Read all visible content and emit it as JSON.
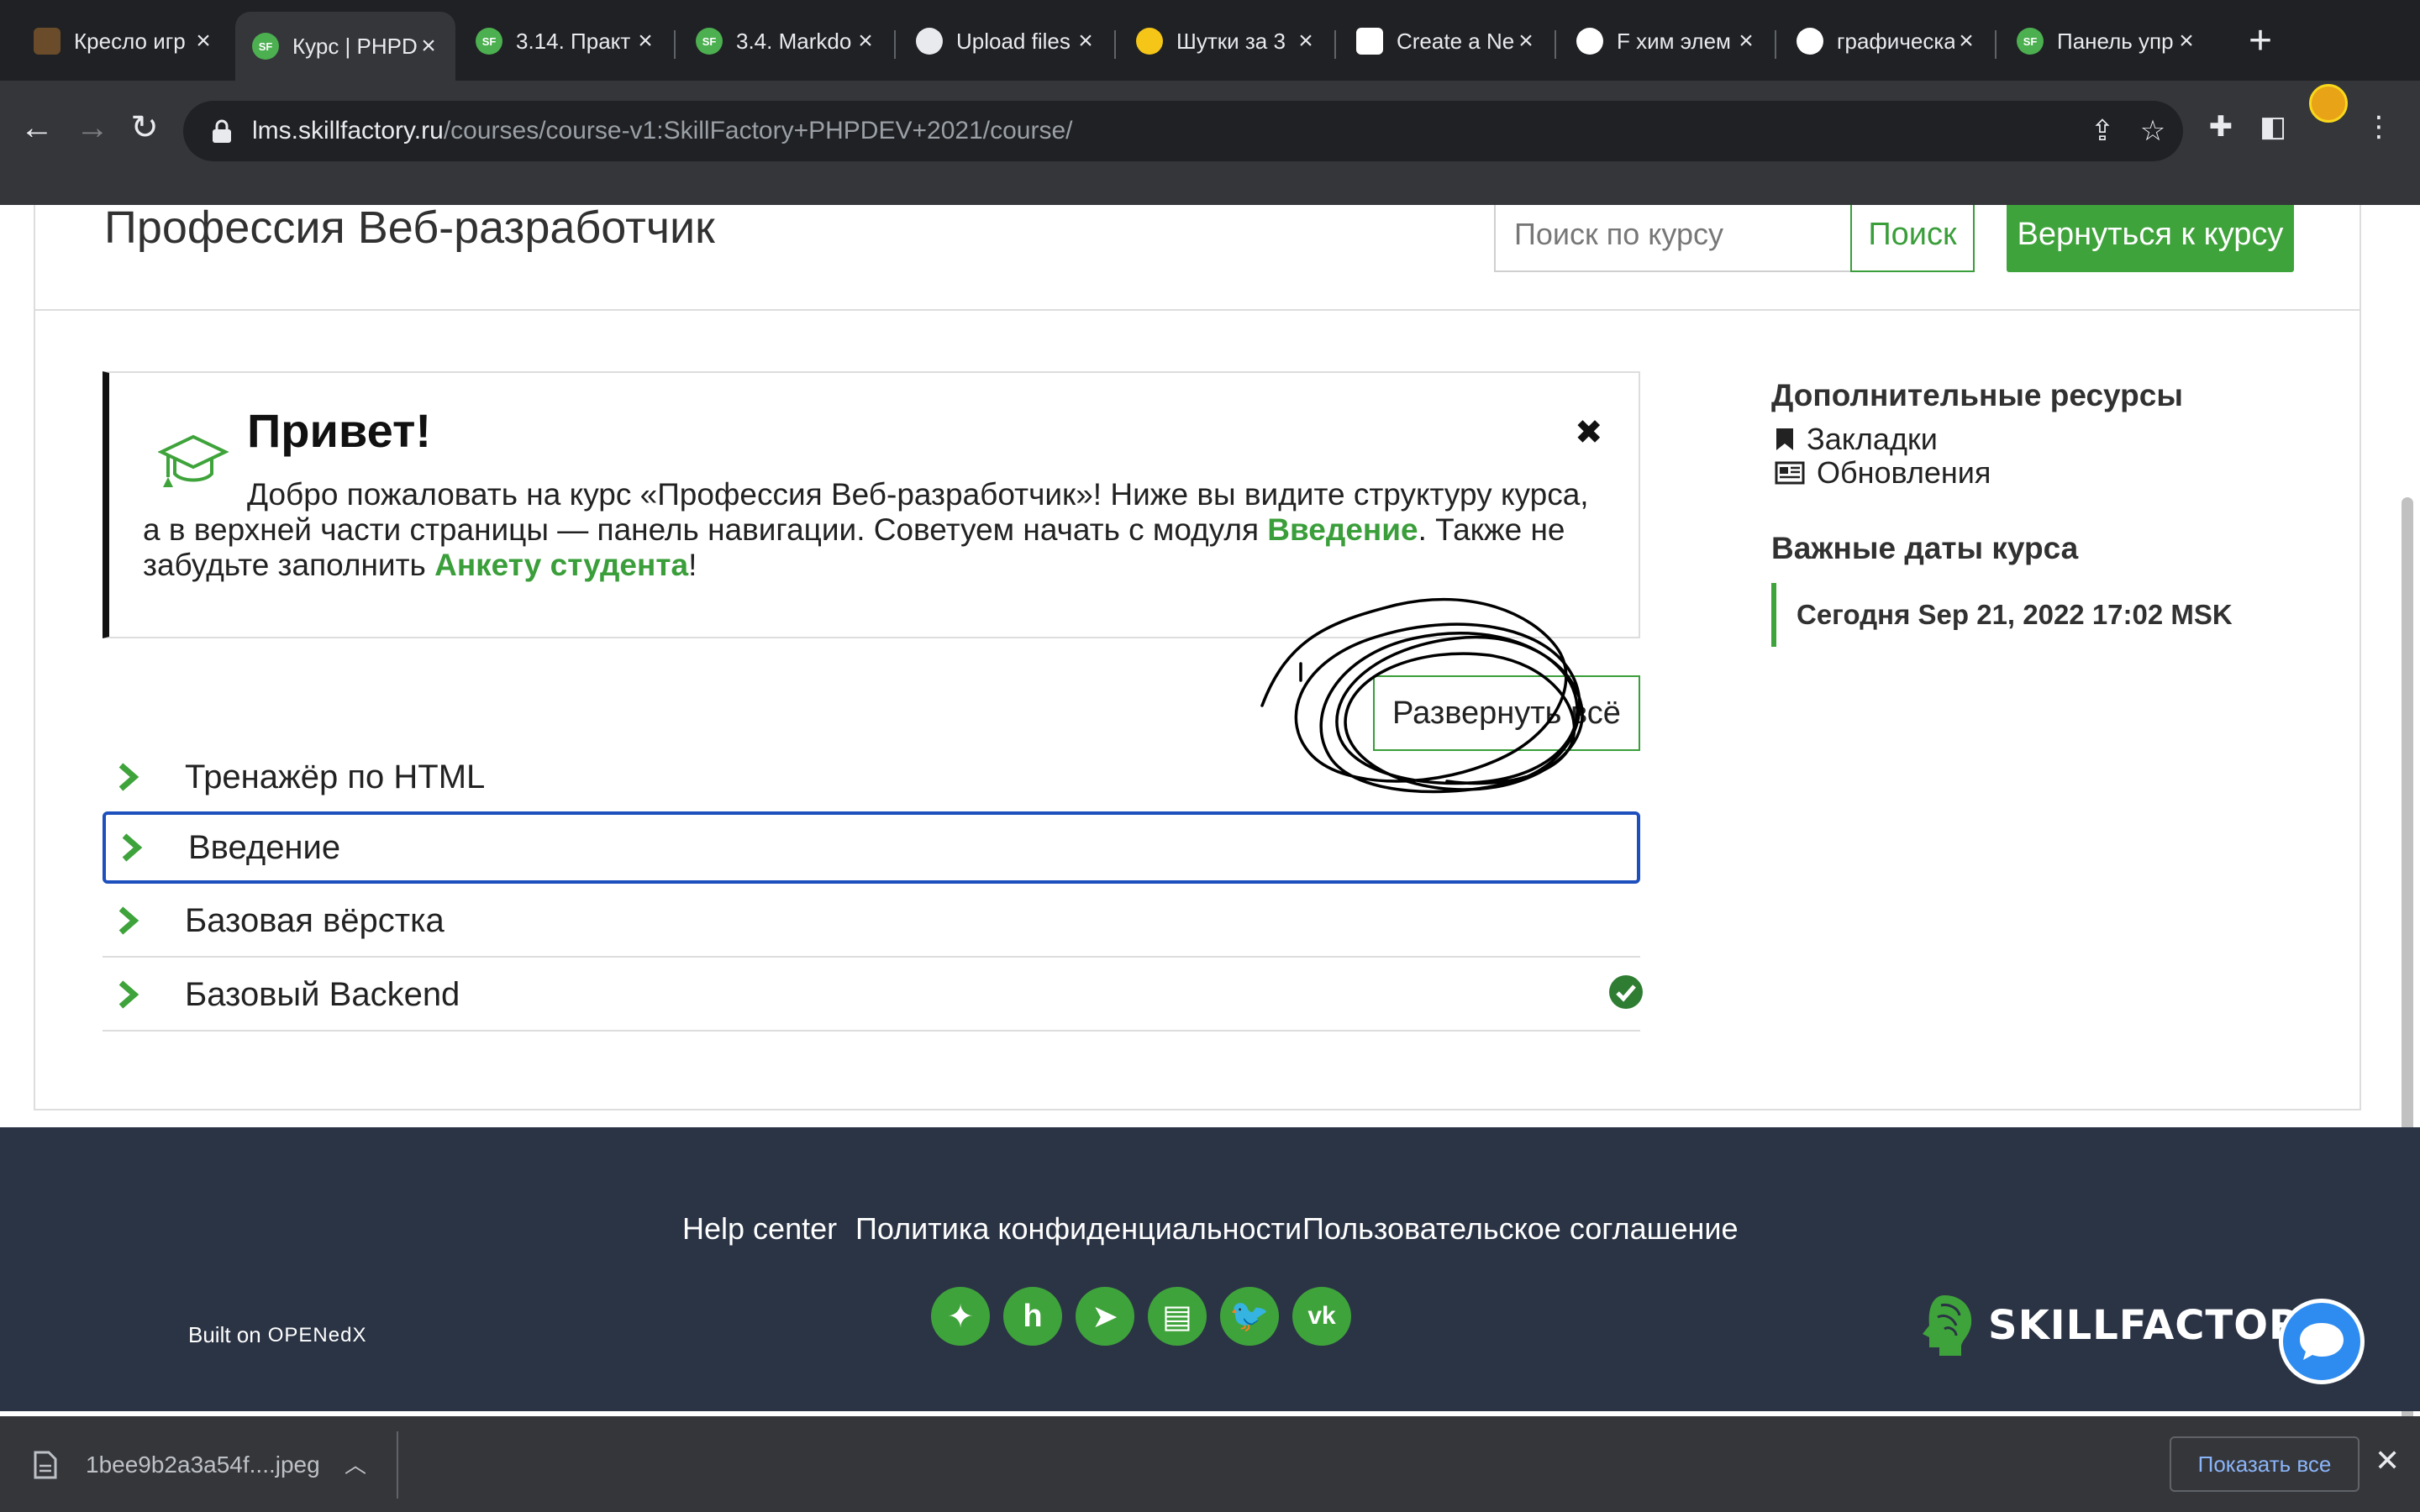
{
  "browser": {
    "tabs": [
      {
        "title": "Кресло игр",
        "icon": "chair-favicon"
      },
      {
        "title": "Курс | PHPD",
        "icon": "skillfactory-favicon",
        "active": true
      },
      {
        "title": "3.14. Практ",
        "icon": "skillfactory-favicon"
      },
      {
        "title": "3.4. Markdo",
        "icon": "skillfactory-favicon"
      },
      {
        "title": "Upload files",
        "icon": "github-favicon"
      },
      {
        "title": "Шутки за 3",
        "icon": "emoji-favicon"
      },
      {
        "title": "Create a Ne",
        "icon": "codepen-favicon"
      },
      {
        "title": "F хим элем",
        "icon": "google-favicon"
      },
      {
        "title": "графическа",
        "icon": "google-favicon"
      },
      {
        "title": "Панель упр",
        "icon": "skillfactory-favicon"
      }
    ],
    "favicon_label": "SF",
    "url_host": "lms.skillfactory.ru",
    "url_path": "/courses/course-v1:SkillFactory+PHPDEV+2021/course/"
  },
  "course": {
    "title": "Профессия Веб-разработчик",
    "search_placeholder": "Поиск по курсу",
    "search_button": "Поиск",
    "resume_button": "Вернуться к курсу"
  },
  "welcome": {
    "title": "Привет!",
    "close_glyph": "✖",
    "text_1": "Добро пожаловать на курс «Профессия Веб-разработчик»! Ниже вы видите структуру курса, а в верхней части страницы — панель навигации. Советуем начать с модуля ",
    "link_1": "Введение",
    "text_2": ". Также не забудьте заполнить ",
    "link_2": "Анкету студента",
    "text_3": "!"
  },
  "outline": {
    "expand_all": "Развернуть всё",
    "sections": [
      {
        "label": "Тренажёр по HTML"
      },
      {
        "label": "Введение",
        "focused": true
      },
      {
        "label": "Базовая вёрстка"
      },
      {
        "label": "Базовый Backend",
        "completed": true
      }
    ]
  },
  "sidebar": {
    "resources_title": "Дополнительные ресурсы",
    "bookmarks": "Закладки",
    "updates": "Обновления",
    "dates_title": "Важные даты курса",
    "today": "Сегодня Sep 21, 2022 17:02 MSK"
  },
  "footer": {
    "links": [
      "Help center",
      "Политика конфиденциальности",
      "Пользовательское соглашение"
    ],
    "built_on": "Built on",
    "openedx": "OPENedX",
    "social": [
      "zen-icon",
      "habr-icon",
      "telegram-icon",
      "chat-icon",
      "twitter-icon",
      "vk-icon"
    ],
    "social_glyphs": [
      "✦",
      "h",
      "➤",
      "▤",
      "🐦",
      "vk"
    ],
    "logo": "SKILLFACTORY"
  },
  "downloads": {
    "file": "1bee9b2a3a54f....jpeg",
    "show_all": "Показать все"
  },
  "colors": {
    "accent_green": "#3fa33b",
    "focus_blue": "#1d4fbd",
    "footer_bg": "#2b3445"
  }
}
